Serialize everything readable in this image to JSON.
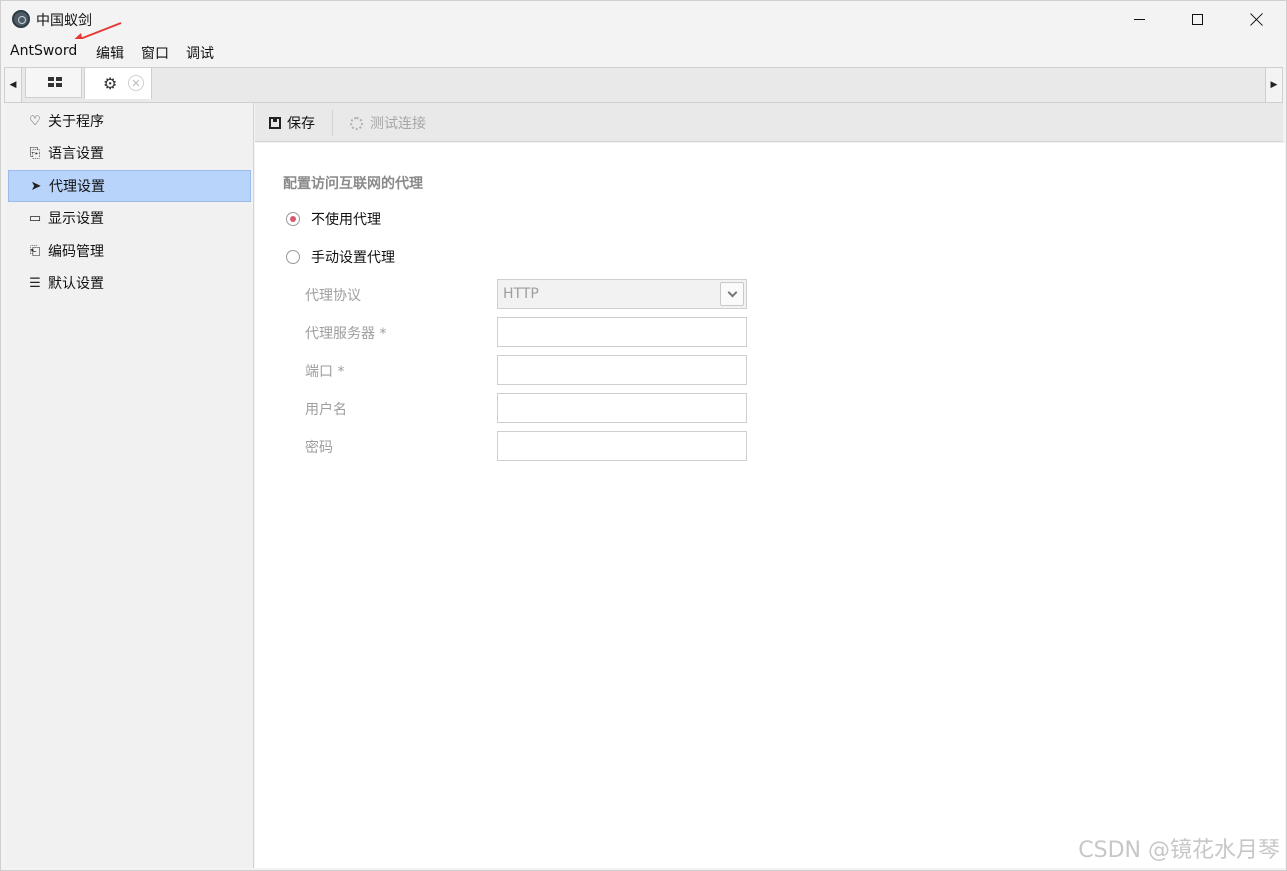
{
  "window": {
    "title": "中国蚁剑"
  },
  "menu": [
    "AntSword",
    "编辑",
    "窗口",
    "调试"
  ],
  "tabs": {
    "scroll_left": "◀",
    "scroll_right": "▶",
    "close_glyph": "✕"
  },
  "sidebar": {
    "items": [
      {
        "label": "关于程序",
        "icon": "heart-icon",
        "glyph": "♡"
      },
      {
        "label": "语言设置",
        "icon": "language-icon",
        "glyph": "⎘"
      },
      {
        "label": "代理设置",
        "icon": "paper-plane-icon",
        "glyph": "➤",
        "active": true
      },
      {
        "label": "显示设置",
        "icon": "monitor-icon",
        "glyph": "▭"
      },
      {
        "label": "编码管理",
        "icon": "code-file-icon",
        "glyph": "⎗"
      },
      {
        "label": "默认设置",
        "icon": "sliders-icon",
        "glyph": "☰"
      }
    ]
  },
  "toolbar": {
    "save_label": "保存",
    "test_label": "测试连接"
  },
  "proxy": {
    "section_title": "配置访问互联网的代理",
    "option_none": "不使用代理",
    "option_manual": "手动设置代理",
    "selected": "none",
    "fields": {
      "protocol_label": "代理协议",
      "protocol_value": "HTTP",
      "server_label": "代理服务器 *",
      "port_label": "端口 *",
      "username_label": "用户名",
      "password_label": "密码"
    }
  },
  "colors": {
    "active_item": "#b8d4fb",
    "annotation_arrow": "#e53935"
  },
  "watermark": "CSDN @镜花水月琴"
}
